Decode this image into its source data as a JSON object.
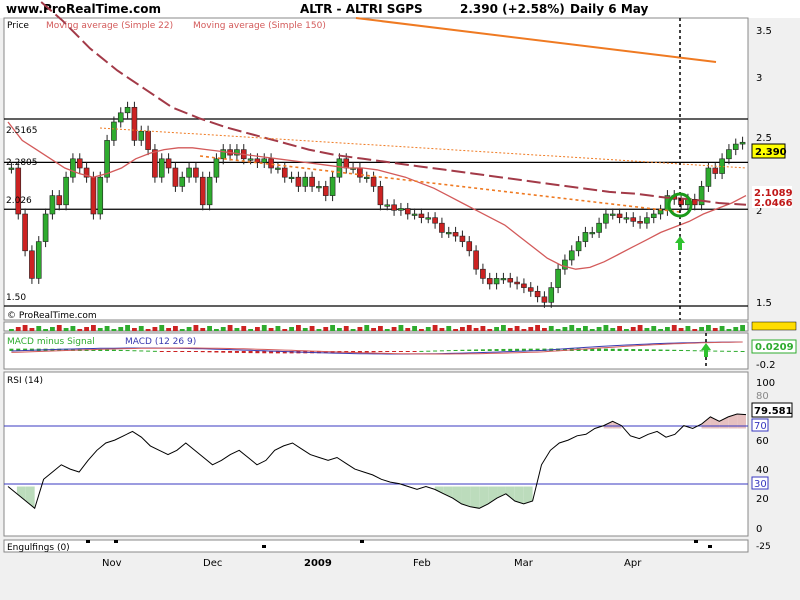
{
  "header": {
    "site": "www.ProRealTime.com",
    "instrument": "ALTR - ALTRI SGPS",
    "quote": "2.390 (+2.58%)",
    "period": "Daily  6 May"
  },
  "legend": {
    "price": "Price",
    "ma22": "Moving average (Simple 22)",
    "ma150": "Moving average (Simple 150)",
    "copyright": "© ProRealTime.com"
  },
  "price_panel": {
    "level_labels": [
      "2.5165",
      "2.2805",
      "2.026",
      "1.50"
    ],
    "axis_ticks": [
      "3.5",
      "3",
      "2.5",
      "2",
      "1.5"
    ],
    "last_price_tag": "2.390",
    "ma22_tag": "2.1089",
    "ma150_tag": "2.0466"
  },
  "macd_panel": {
    "label_hist": "MACD minus Signal",
    "label_macd": "MACD (12 26 9)",
    "value_tag": "0.0209",
    "axis_tick": "-0.2"
  },
  "rsi_panel": {
    "label": "RSI (14)",
    "value_tag": "79.581",
    "ticks": [
      "100",
      "80",
      "60",
      "40",
      "20",
      "0"
    ],
    "level_tags": [
      "70",
      "30"
    ]
  },
  "engulfings_panel": {
    "label": "Engulfings (0)",
    "tick": "-25"
  },
  "x_axis": {
    "labels": [
      "Nov",
      "Dec",
      "2009",
      "Feb",
      "Mar",
      "Apr"
    ]
  },
  "colors": {
    "up": "#2eab2e",
    "down": "#cc2222",
    "ma22": "#d35a5a",
    "ma150": "#a33a48",
    "orange": "#ef7a22",
    "rsi_line": "#000000",
    "level_line": "#3838c0",
    "tag_red": "#c01818",
    "tag_yellow": "#ffff00",
    "rsi_fill_low": "#bcdcbc",
    "rsi_fill_high": "#e6c0c0"
  },
  "chart_data": [
    {
      "type": "candlestick",
      "title": "ALTR - ALTRI SGPS",
      "ylim": [
        1.45,
        3.6
      ],
      "x_labels": [
        "Nov",
        "Dec",
        "2009",
        "Feb",
        "Mar",
        "Apr"
      ],
      "horizontal_levels": [
        2.5165,
        2.2805,
        2.026,
        1.5
      ],
      "series": [
        {
          "name": "Price",
          "close": [
            2.25,
            2.0,
            1.8,
            1.65,
            1.85,
            2.0,
            2.1,
            2.05,
            2.2,
            2.3,
            2.25,
            2.2,
            2.0,
            2.2,
            2.4,
            2.5,
            2.55,
            2.58,
            2.4,
            2.45,
            2.35,
            2.2,
            2.3,
            2.25,
            2.15,
            2.2,
            2.25,
            2.2,
            2.05,
            2.2,
            2.3,
            2.35,
            2.32,
            2.35,
            2.3,
            2.3,
            2.28,
            2.3,
            2.25,
            2.25,
            2.2,
            2.2,
            2.15,
            2.2,
            2.15,
            2.15,
            2.1,
            2.2,
            2.3,
            2.25,
            2.25,
            2.2,
            2.2,
            2.15,
            2.05,
            2.05,
            2.02,
            2.03,
            2.0,
            2.0,
            1.98,
            1.98,
            1.95,
            1.9,
            1.9,
            1.88,
            1.85,
            1.8,
            1.7,
            1.65,
            1.62,
            1.65,
            1.65,
            1.63,
            1.62,
            1.6,
            1.58,
            1.55,
            1.52,
            1.6,
            1.7,
            1.75,
            1.8,
            1.85,
            1.9,
            1.9,
            1.95,
            2.0,
            2.0,
            1.98,
            1.98,
            1.96,
            1.95,
            1.98,
            2.0,
            2.02,
            2.1,
            2.08,
            2.05,
            2.08,
            2.05,
            2.15,
            2.25,
            2.22,
            2.3,
            2.35,
            2.38,
            2.39
          ],
          "ma22": [
            2.5,
            2.4,
            2.35,
            2.3,
            2.25,
            2.22,
            2.2,
            2.22,
            2.25,
            2.3,
            2.33,
            2.35,
            2.36,
            2.36,
            2.35,
            2.34,
            2.33,
            2.32,
            2.31,
            2.3,
            2.29,
            2.28,
            2.27,
            2.26,
            2.25,
            2.25,
            2.24,
            2.22,
            2.2,
            2.17,
            2.14,
            2.1,
            2.06,
            2.02,
            1.98,
            1.94,
            1.88,
            1.82,
            1.76,
            1.72,
            1.7,
            1.71,
            1.74,
            1.78,
            1.82,
            1.86,
            1.9,
            1.93,
            1.96,
            2.0,
            2.03,
            2.06,
            2.1
          ],
          "ma150": [
            3.25,
            3.18,
            3.05,
            2.9,
            2.78,
            2.68,
            2.58,
            2.52,
            2.47,
            2.43,
            2.39,
            2.35,
            2.32,
            2.3,
            2.28,
            2.26,
            2.24,
            2.22,
            2.2,
            2.18,
            2.16,
            2.14,
            2.12,
            2.11,
            2.09,
            2.08,
            2.06,
            2.05
          ],
          "last": 2.39,
          "ma22_last": 2.1089,
          "ma150_last": 2.0466
        }
      ]
    },
    {
      "type": "bar",
      "title": "MACD minus Signal / MACD (12 26 9)",
      "value_last": 0.0209
    },
    {
      "type": "line",
      "title": "RSI (14)",
      "ylim": [
        -5,
        103
      ],
      "levels": [
        70,
        30
      ],
      "values": [
        30,
        25,
        20,
        15,
        35,
        40,
        45,
        42,
        40,
        48,
        55,
        60,
        62,
        65,
        68,
        64,
        58,
        55,
        52,
        55,
        60,
        55,
        50,
        45,
        48,
        52,
        55,
        50,
        45,
        48,
        55,
        58,
        60,
        56,
        52,
        50,
        48,
        50,
        46,
        42,
        40,
        38,
        35,
        33,
        32,
        30,
        28,
        30,
        28,
        25,
        22,
        18,
        16,
        15,
        18,
        22,
        25,
        20,
        18,
        20,
        45,
        55,
        60,
        62,
        65,
        66,
        70,
        72,
        75,
        72,
        65,
        63,
        66,
        68,
        64,
        66,
        72,
        70,
        73,
        78,
        75,
        78,
        80,
        79.581
      ],
      "last": 79.581
    },
    {
      "type": "line",
      "title": "Engulfings (0)"
    }
  ]
}
